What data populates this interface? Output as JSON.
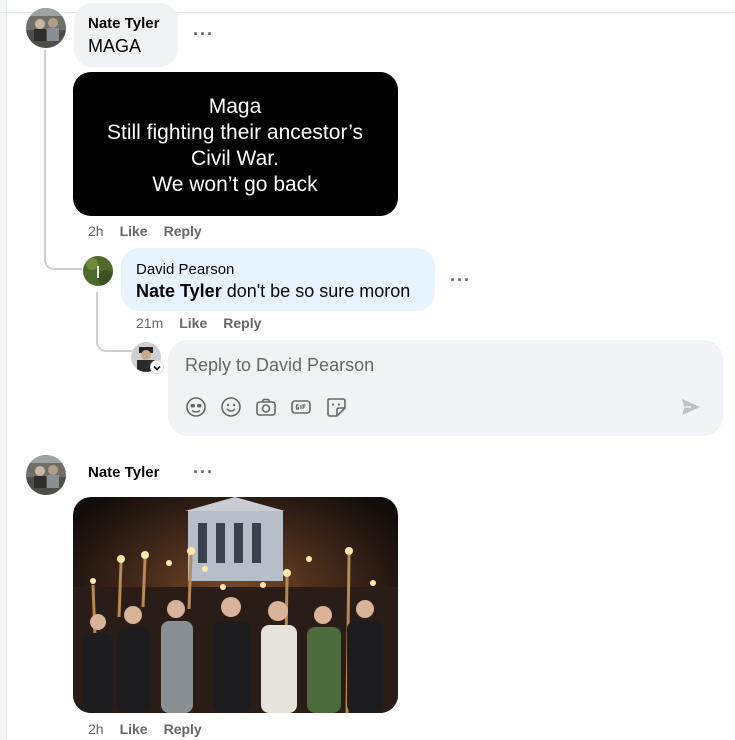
{
  "comments": [
    {
      "author": "Nate Tyler",
      "text": "MAGA",
      "more": "···",
      "image": {
        "kind": "meme",
        "lines": [
          "Maga",
          "Still fighting their ancestor’s",
          "Civil War.",
          "We won’t go back"
        ]
      },
      "meta": {
        "time": "2h",
        "like": "Like",
        "reply": "Reply"
      }
    }
  ],
  "reply": {
    "author": "David Pearson",
    "mention": "Nate Tyler",
    "text": " don't be so sure moron",
    "more": "···",
    "meta": {
      "time": "21m",
      "like": "Like",
      "reply": "Reply"
    }
  },
  "composer": {
    "placeholder": "Reply to David Pearson",
    "icons": [
      "avatar-sticker-icon",
      "emoji-icon",
      "camera-icon",
      "gif-icon",
      "sticker-icon"
    ],
    "send_icon": "send-icon"
  },
  "comment2": {
    "author": "Nate Tyler",
    "more": "···",
    "image": {
      "kind": "photo",
      "description_icon": "photo-icon"
    },
    "meta": {
      "time": "2h",
      "like": "Like",
      "reply": "Reply"
    }
  },
  "colors": {
    "bubble": "#f0f2f5",
    "reply_bubble": "#e7f3ff",
    "meta": "#65676b"
  }
}
